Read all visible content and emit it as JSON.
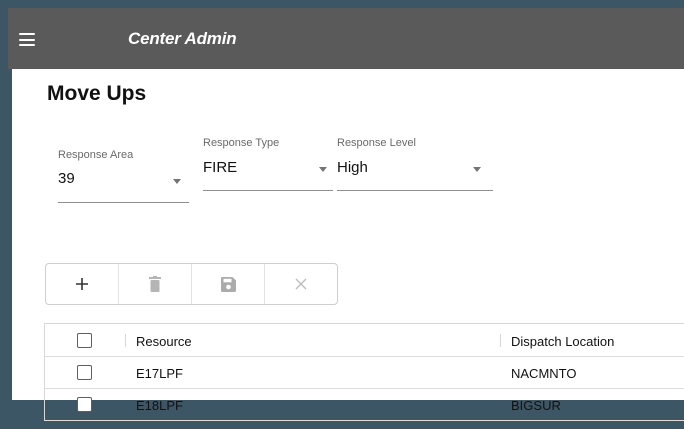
{
  "app_bar": {
    "title": "Center Admin",
    "menu_icon": "hamburger-menu-icon"
  },
  "page": {
    "title": "Move Ups"
  },
  "filters": {
    "response_area": {
      "label": "Response Area",
      "value": "39"
    },
    "response_type": {
      "label": "Response Type",
      "value": "FIRE"
    },
    "response_level": {
      "label": "Response Level",
      "value": "High"
    }
  },
  "toolbar": {
    "buttons": [
      {
        "icon": "add-icon",
        "enabled": true
      },
      {
        "icon": "delete-icon",
        "enabled": false
      },
      {
        "icon": "save-icon",
        "enabled": false
      },
      {
        "icon": "close-icon",
        "enabled": false
      }
    ]
  },
  "grid": {
    "columns": [
      "Resource",
      "Dispatch Location"
    ],
    "rows": [
      {
        "resource": "E17LPF",
        "dispatch_location": "NACMNTO"
      },
      {
        "resource": "E18LPF",
        "dispatch_location": "BIGSUR"
      }
    ]
  },
  "colors": {
    "app_bar": "#5a5a5a",
    "background": "#3d5666"
  }
}
